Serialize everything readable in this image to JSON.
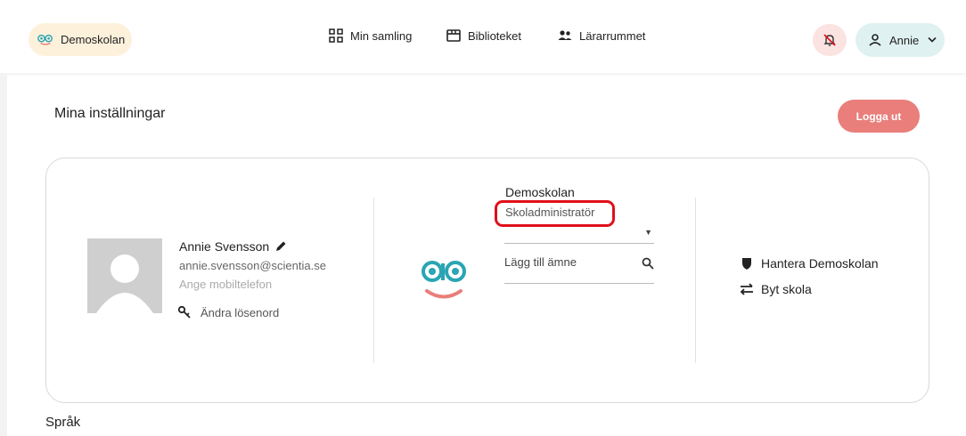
{
  "topbar": {
    "school": "Demoskolan",
    "nav": [
      {
        "label": "Min samling",
        "icon": "grid-icon"
      },
      {
        "label": "Biblioteket",
        "icon": "library-icon"
      },
      {
        "label": "Lärarrummet",
        "icon": "people-icon"
      }
    ],
    "user": "Annie",
    "colors": {
      "school_pill": "#fdf1dc",
      "bell_bg": "#fbe3e2",
      "user_bg": "#dff2f1",
      "accent": "#e97e7b",
      "logo_teal": "#2aa5b4"
    }
  },
  "page": {
    "title": "Mina inställningar",
    "logout": "Logga ut"
  },
  "profile": {
    "name": "Annie Svensson",
    "email": "annie.svensson@scientia.se",
    "phone_placeholder": "Ange mobiltelefon",
    "change_password": "Ändra lösenord"
  },
  "school": {
    "name": "Demoskolan",
    "role": "Skoladministratör",
    "subject_placeholder": "Lägg till ämne"
  },
  "actions": {
    "manage": "Hantera Demoskolan",
    "switch": "Byt skola"
  },
  "language_heading": "Språk"
}
